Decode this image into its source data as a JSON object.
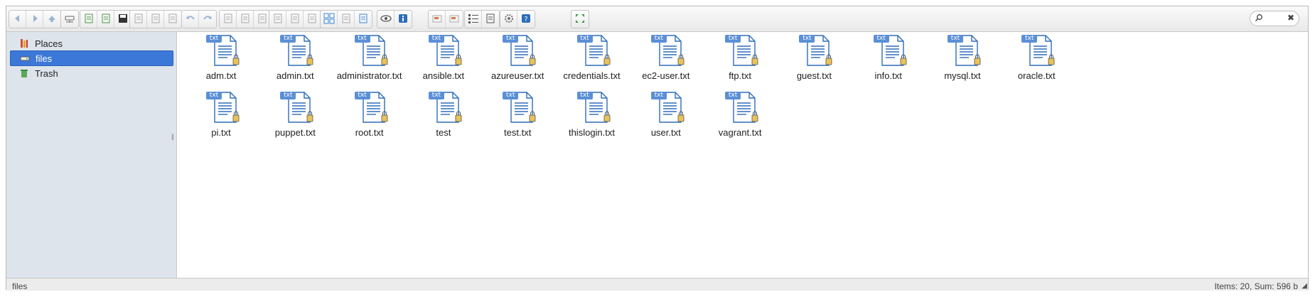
{
  "toolbar": {
    "groups": [
      [
        "back-icon",
        "forward-icon",
        "up-icon"
      ],
      [
        "network-drive-icon"
      ],
      [
        "new-folder-icon",
        "new-file-icon",
        "save-icon"
      ],
      [
        "open-icon",
        "download-icon",
        "select-icon"
      ],
      [
        "undo-icon",
        "redo-icon"
      ],
      [
        "copy-icon",
        "cut-icon",
        "paste-icon",
        "duplicate-icon",
        "delete-icon",
        "clear-icon"
      ],
      [
        "rename-icon",
        "select-all-icon",
        "edit-icon",
        "resize-icon"
      ],
      [
        "icons-view-icon",
        "thumbnails-view-icon",
        "list-view-icon"
      ],
      [
        "preview-icon",
        "info-icon"
      ],
      [
        "archive-icon",
        "extract-icon"
      ],
      [
        "details-icon",
        "columns-icon"
      ],
      [
        "settings-icon",
        "help-icon"
      ],
      [
        "fullscreen-icon"
      ]
    ]
  },
  "search": {
    "placeholder": "",
    "clear": "✖"
  },
  "sidebar": {
    "items": [
      {
        "label": "Places",
        "icon": "places-icon",
        "selected": false
      },
      {
        "label": "files",
        "icon": "drive-icon",
        "selected": true
      },
      {
        "label": "Trash",
        "icon": "trash-icon",
        "selected": false
      }
    ]
  },
  "files": [
    {
      "name": "adm.txt",
      "badge": "txt"
    },
    {
      "name": "admin.txt",
      "badge": "txt"
    },
    {
      "name": "administrator.txt",
      "badge": "txt"
    },
    {
      "name": "ansible.txt",
      "badge": "txt"
    },
    {
      "name": "azureuser.txt",
      "badge": "txt"
    },
    {
      "name": "credentials.txt",
      "badge": "txt"
    },
    {
      "name": "ec2-user.txt",
      "badge": "txt"
    },
    {
      "name": "ftp.txt",
      "badge": "txt"
    },
    {
      "name": "guest.txt",
      "badge": "txt"
    },
    {
      "name": "info.txt",
      "badge": "txt"
    },
    {
      "name": "mysql.txt",
      "badge": "txt"
    },
    {
      "name": "oracle.txt",
      "badge": "txt"
    },
    {
      "name": "pi.txt",
      "badge": "txt"
    },
    {
      "name": "puppet.txt",
      "badge": "txt"
    },
    {
      "name": "root.txt",
      "badge": "txt"
    },
    {
      "name": "test",
      "badge": "txt"
    },
    {
      "name": "test.txt",
      "badge": "txt"
    },
    {
      "name": "thislogin.txt",
      "badge": "txt"
    },
    {
      "name": "user.txt",
      "badge": "txt"
    },
    {
      "name": "vagrant.txt",
      "badge": "txt"
    }
  ],
  "status": {
    "path": "files",
    "summary": "Items: 20, Sum: 596 b"
  },
  "colors": {
    "selection": "#3c78d8",
    "sidebar": "#dde4ec",
    "icon_blue": "#2e6db8",
    "badge": "#5b8fd6"
  }
}
